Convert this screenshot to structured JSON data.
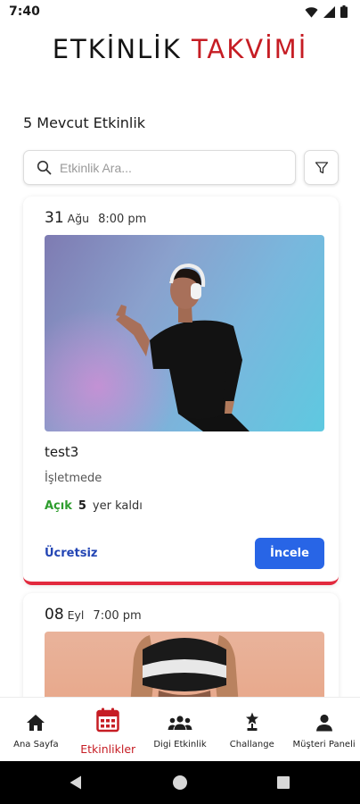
{
  "status_bar": {
    "time": "7:40"
  },
  "header": {
    "title_part1": "ETKİNLİK",
    "title_part2": "TAKVİMİ"
  },
  "summary": {
    "count_text": "5 Mevcut Etkinlik"
  },
  "search": {
    "placeholder": "Etkinlik Ara..."
  },
  "events": [
    {
      "day": "31",
      "month": "Ağu",
      "time": "8:00 pm",
      "name": "test3",
      "venue": "İşletmede",
      "status": "Açık",
      "spots_count": "5",
      "spots_label": "yer kaldı",
      "price": "Ücretsiz",
      "action_label": "İncele"
    },
    {
      "day": "08",
      "month": "Eyl",
      "time": "7:00 pm"
    }
  ],
  "bottom_nav": {
    "items": [
      {
        "label": "Ana Sayfa",
        "icon": "home-icon"
      },
      {
        "label": "Etkinlikler",
        "icon": "calendar-icon",
        "active": true
      },
      {
        "label": "Digi Etkinlik",
        "icon": "group-icon"
      },
      {
        "label": "Challange",
        "icon": "trophy-icon"
      },
      {
        "label": "Müşteri Paneli",
        "icon": "person-icon"
      }
    ]
  },
  "colors": {
    "brand_red": "#c61d24",
    "primary_blue": "#2865e6",
    "open_green": "#2e9d2e",
    "price_blue": "#2345b4",
    "card_accent": "#e22a3e"
  }
}
